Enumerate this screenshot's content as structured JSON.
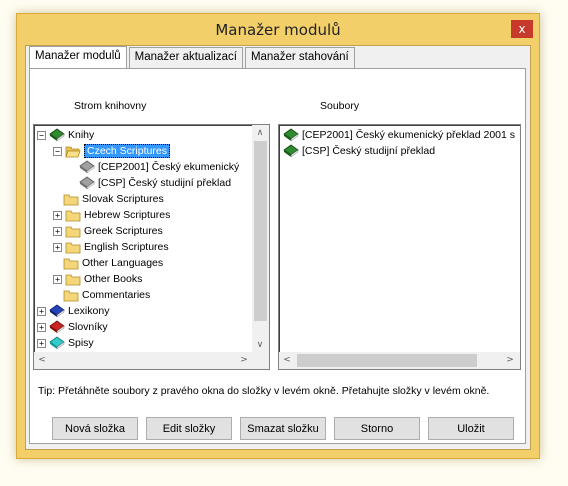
{
  "window": {
    "title": "Manažer modulů",
    "close_label": "x"
  },
  "tabs": [
    "Manažer modulů",
    "Manažer aktualizací",
    "Manažer stahování"
  ],
  "left_pane": {
    "label": "Strom knihovny"
  },
  "right_pane": {
    "label": "Soubory"
  },
  "tree": [
    {
      "label": "Knihy",
      "level": 0,
      "expander": "−",
      "icon": "green-book-icon"
    },
    {
      "label": "Czech Scriptures",
      "level": 1,
      "expander": "−",
      "icon": "open-folder-icon",
      "selected": true
    },
    {
      "label": "[CEP2001] Český ekumenický",
      "level": 2,
      "icon": "grey-book-icon"
    },
    {
      "label": "[CSP] Český studijní překlad",
      "level": 2,
      "icon": "grey-book-icon"
    },
    {
      "label": "Slovak Scriptures",
      "level": 1,
      "icon": "folder-icon"
    },
    {
      "label": "Hebrew Scriptures",
      "level": 1,
      "expander": "+",
      "icon": "folder-icon"
    },
    {
      "label": "Greek Scriptures",
      "level": 1,
      "expander": "+",
      "icon": "folder-icon"
    },
    {
      "label": "English Scriptures",
      "level": 1,
      "expander": "+",
      "icon": "folder-icon"
    },
    {
      "label": "Other Languages",
      "level": 1,
      "icon": "folder-icon"
    },
    {
      "label": "Other Books",
      "level": 1,
      "expander": "+",
      "icon": "folder-icon"
    },
    {
      "label": "Commentaries",
      "level": 1,
      "icon": "folder-icon"
    },
    {
      "label": "Lexikony",
      "level": 0,
      "expander": "+",
      "icon": "blue-book-icon"
    },
    {
      "label": "Slovníky",
      "level": 0,
      "expander": "+",
      "icon": "red-book-icon"
    },
    {
      "label": "Spisy",
      "level": 0,
      "expander": "+",
      "icon": "cyan-book-icon"
    }
  ],
  "files": [
    {
      "label": "[CEP2001] Český ekumenický překlad 2001 s",
      "icon": "green-book-icon"
    },
    {
      "label": "[CSP] Český studijní překlad",
      "icon": "green-book-icon"
    }
  ],
  "tip": "Tip: Přetáhněte soubory z pravého okna do složky v levém okně. Přetahujte složky v levém okně.",
  "buttons": [
    "Nová složka",
    "Edit složky",
    "Smazat složku",
    "Storno",
    "Uložit"
  ],
  "scroll_arrows": {
    "up": "∧",
    "down": "∨",
    "left": "<",
    "right": ">"
  },
  "colors": {
    "window_frame": "#f3cf6a",
    "close_button": "#c7392b",
    "selection": "#3399ff",
    "folder": "#f5d67a",
    "green_book": "#2e8b2e",
    "blue_book": "#2244bb",
    "red_book": "#cc2222",
    "cyan_book": "#33cccc",
    "grey_book": "#a0a0a0"
  }
}
